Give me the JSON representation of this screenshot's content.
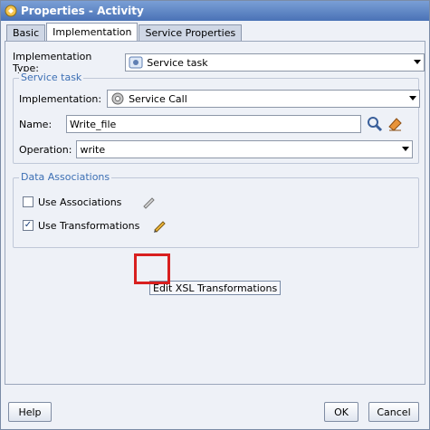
{
  "window": {
    "title": "Properties - Activity"
  },
  "tabs": [
    {
      "label": "Basic"
    },
    {
      "label": "Implementation"
    },
    {
      "label": "Service Properties"
    }
  ],
  "implementation_type": {
    "label": "Implementation Type:",
    "value": "Service task"
  },
  "service_task": {
    "group_title": "Service task",
    "implementation_label": "Implementation:",
    "implementation_value": "Service Call",
    "name_label": "Name:",
    "name_value": "Write_file",
    "operation_label": "Operation:",
    "operation_value": "write"
  },
  "data_associations": {
    "group_title": "Data Associations",
    "use_associations_label": "Use Associations",
    "use_associations_checked": false,
    "use_transformations_label": "Use Transformations",
    "use_transformations_checked": true,
    "tooltip": "Edit XSL Transformations"
  },
  "buttons": {
    "help": "Help",
    "ok": "OK",
    "cancel": "Cancel"
  },
  "colors": {
    "highlight": "#d81f1f",
    "group_title": "#3c6fb4"
  },
  "icons": [
    "app-icon",
    "service-task-icon",
    "gear-icon",
    "search-icon",
    "eraser-icon",
    "pencil-icon",
    "chevron-down-icon"
  ]
}
